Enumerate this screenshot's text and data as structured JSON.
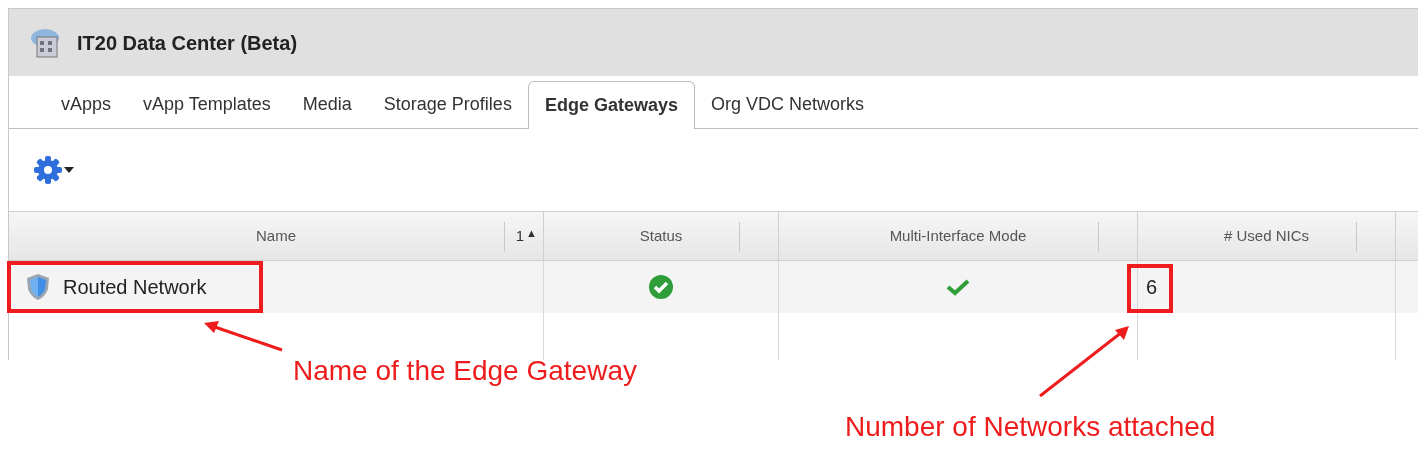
{
  "window": {
    "title": "IT20 Data Center (Beta)"
  },
  "tabs": [
    {
      "label": "vApps",
      "selected": false
    },
    {
      "label": "vApp Templates",
      "selected": false
    },
    {
      "label": "Media",
      "selected": false
    },
    {
      "label": "Storage Profiles",
      "selected": false
    },
    {
      "label": "Edge Gateways",
      "selected": true
    },
    {
      "label": "Org VDC Networks",
      "selected": false
    }
  ],
  "table": {
    "columns": [
      {
        "label": "Name",
        "sort_order": "1",
        "sort_arrow": "▲"
      },
      {
        "label": "Status"
      },
      {
        "label": "Multi-Interface Mode"
      },
      {
        "label": "# Used NICs"
      }
    ],
    "rows": [
      {
        "name": "Routed Network",
        "status_ok": true,
        "multi_interface_mode": true,
        "used_nics": "6"
      }
    ]
  },
  "annotations": [
    {
      "text": "Name of the Edge Gateway"
    },
    {
      "text": "Number of Networks attached"
    }
  ]
}
